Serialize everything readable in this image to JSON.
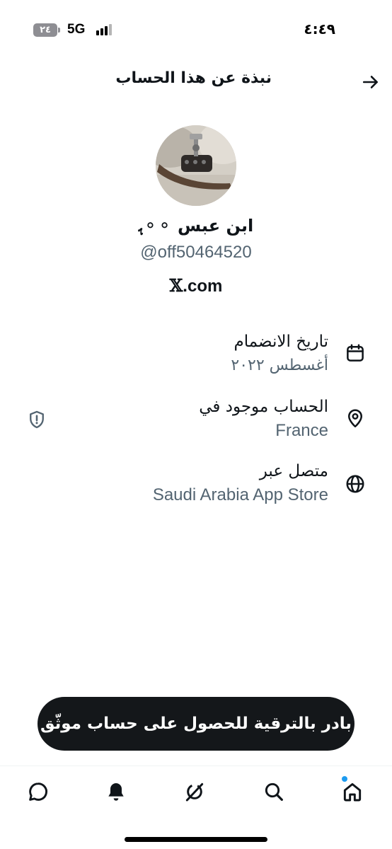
{
  "status_bar": {
    "battery": "٢٤",
    "network": "5G",
    "time": "٤:٤٩"
  },
  "header": {
    "title": "نبذة عن هذا الحساب",
    "back_icon": "arrow-right-icon"
  },
  "profile": {
    "display_name": "ابن عبس ⚬⚬ﮨ",
    "handle": "@off50464520",
    "site_mark": "𝕏",
    "site_suffix": ".com"
  },
  "info": {
    "joined": {
      "label": "تاريخ الانضمام",
      "value": "أغسطس ٢٠٢٢",
      "icon": "calendar-icon"
    },
    "location": {
      "label": "الحساب موجود في",
      "value": "France",
      "icon": "location-pin-icon",
      "badge_icon": "shield-alert-icon"
    },
    "connected": {
      "label": "متصل عبر",
      "value": "Saudi Arabia App Store",
      "icon": "globe-icon"
    }
  },
  "upgrade": {
    "label": "بادر بالترقية للحصول على حساب موثّق"
  },
  "tab_bar": {
    "tabs": [
      "home-icon",
      "search-icon",
      "grok-icon",
      "notifications-icon",
      "messages-icon"
    ]
  },
  "colors": {
    "text": "#0f1419",
    "secondary": "#536471",
    "accent": "#1d9bf0",
    "button_bg": "#14171a"
  }
}
